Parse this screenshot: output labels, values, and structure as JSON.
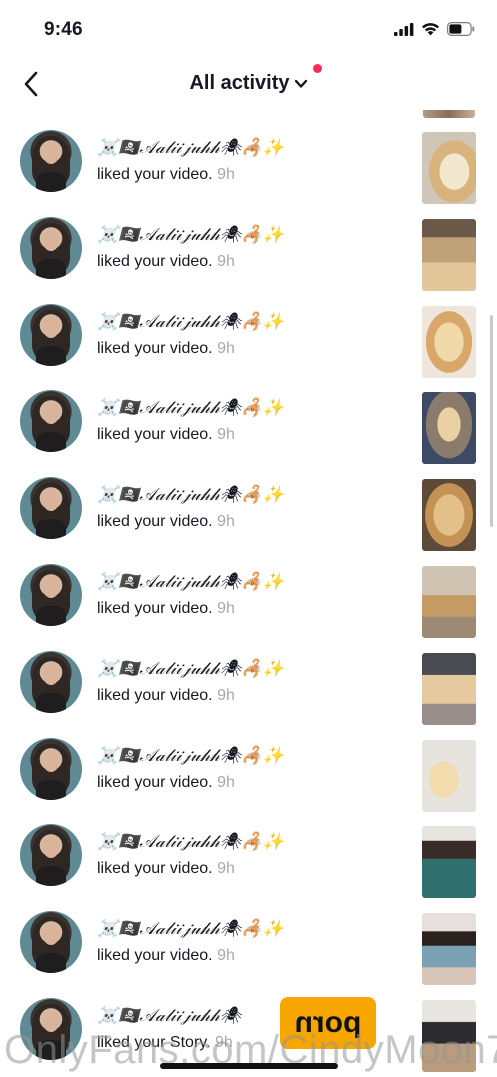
{
  "status_bar": {
    "time": "9:46"
  },
  "header": {
    "title": "All activity",
    "dot_color": "#fe2c55"
  },
  "notifications": [
    {
      "name": "☠️🏴‍☠️𝒜𝒶𝓁𝒾𝒾𝒿𝓊𝒽𝒽🕷🦂✨",
      "action": "liked your video.",
      "time": "9h",
      "thumb": "golden-retriever-closeup"
    },
    {
      "name": "☠️🏴‍☠️𝒜𝒶𝓁𝒾𝒾𝒿𝓊𝒽𝒽🕷🦂✨",
      "action": "liked your video.",
      "time": "9h",
      "thumb": "dog-lying-floor"
    },
    {
      "name": "☠️🏴‍☠️𝒜𝒶𝓁𝒾𝒾𝒿𝓊𝒽𝒽🕷🦂✨",
      "action": "liked your video.",
      "time": "9h",
      "thumb": "dog-tongue-out"
    },
    {
      "name": "☠️🏴‍☠️𝒜𝒶𝓁𝒾𝒾𝒿𝓊𝒽𝒽🕷🦂✨",
      "action": "liked your video.",
      "time": "9h",
      "thumb": "dog-sitting-room"
    },
    {
      "name": "☠️🏴‍☠️𝒜𝒶𝓁𝒾𝒾𝒿𝓊𝒽𝒽🕷🦂✨",
      "action": "liked your video.",
      "time": "9h",
      "thumb": "dog-face-closeup"
    },
    {
      "name": "☠️🏴‍☠️𝒜𝒶𝓁𝒾𝒾𝒿𝓊𝒽𝒽🕷🦂✨",
      "action": "liked your video.",
      "time": "9h",
      "thumb": "dog-standing"
    },
    {
      "name": "☠️🏴‍☠️𝒜𝒶𝓁𝒾𝒾𝒿𝓊𝒽𝒽🕷🦂✨",
      "action": "liked your video.",
      "time": "9h",
      "thumb": "dog-sleeping"
    },
    {
      "name": "☠️🏴‍☠️𝒜𝒶𝓁𝒾𝒾𝒿𝓊𝒽𝒽🕷🦂✨",
      "action": "liked your video.",
      "time": "9h",
      "thumb": "dog-looking-up"
    },
    {
      "name": "☠️🏴‍☠️𝒜𝒶𝓁𝒾𝒾𝒿𝓊𝒽𝒽🕷🦂✨",
      "action": "liked your video.",
      "time": "9h",
      "thumb": "woman-portrait"
    },
    {
      "name": "☠️🏴‍☠️𝒜𝒶𝓁𝒾𝒾𝒿𝓊𝒽𝒽🕷🦂✨",
      "action": "liked your video.",
      "time": "9h",
      "thumb": "woman-mirror-selfie"
    },
    {
      "name": "☠️🏴‍☠️𝒜𝒶𝓁𝒾𝒾𝒿𝓊𝒽𝒽🕷",
      "action": "liked your Story.",
      "time": "9h",
      "thumb": "room-photo"
    }
  ],
  "watermark": {
    "badge": "porn",
    "text": "OnlyFans.com/CindyMoon7"
  }
}
